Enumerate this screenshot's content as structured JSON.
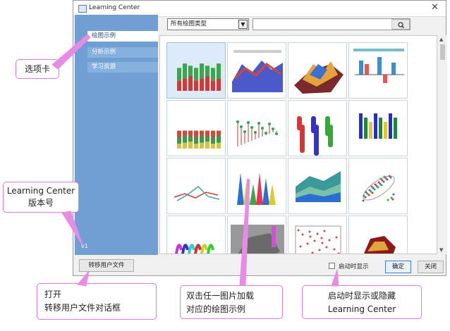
{
  "window": {
    "title": "Learning Center"
  },
  "sidebar": {
    "items": [
      {
        "label": "绘图示例",
        "active": true
      },
      {
        "label": "分析示例",
        "active": false
      },
      {
        "label": "学习资源",
        "active": false
      }
    ],
    "version": "v1"
  },
  "toolbar": {
    "category_select": "所有绘图类型",
    "search_value": "",
    "search_icon": "search-icon"
  },
  "gallery": {
    "thumbnails": [
      "3D bar chart (red/green)",
      "3D surface map",
      "3D colormap surface",
      "grouped bar chart",
      "3D bar with error",
      "3D scatter with drop lines",
      "3D cylinder bars",
      "3D bar columns",
      "3D waterfall lines",
      "3D stacked cones",
      "3D stacked area",
      "3D scatter ellipses",
      "3D ribbon plot",
      "3D surface image",
      "3D scatter grid",
      "3D polar plot"
    ]
  },
  "buttons": {
    "transfer": "转移用户文件",
    "show_on_start": "启动时显示",
    "ok": "确定",
    "close": "关闭"
  },
  "colors": {
    "sidebar": "#6f9fd3",
    "accent": "#e07adf"
  },
  "callouts": {
    "tab": "选项卡",
    "version": "Learning Center\n版本号",
    "transfer": "打开\n转移用户文件对话框",
    "gallery": "双击任一图片加载\n对应的绘图示例",
    "startup": "启动时显示或隐藏\nLearning Center"
  }
}
